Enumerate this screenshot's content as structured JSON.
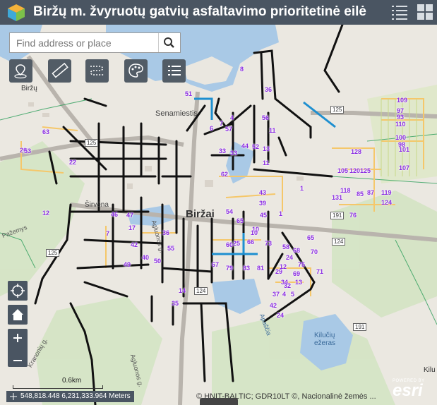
{
  "header": {
    "title": "Biržų m. žvyruotų gatvių asfaltavimo prioritetinė eilė"
  },
  "search": {
    "placeholder": "Find address or place"
  },
  "tools": [
    "locate-tool",
    "measure-tool",
    "layers-tool",
    "basemap-tool",
    "legend-tool"
  ],
  "map": {
    "places": [
      "Biržai",
      "Senamiestis",
      "Širvėna",
      "Kilučių ežeras",
      "Apaščia",
      "Kilu",
      "Biržų"
    ],
    "street_labels": [
      "Pažemys",
      "Kranonių g.",
      "Agluonos g.",
      "Agluonos g."
    ],
    "road_shields": [
      "125",
      "191",
      "125",
      "191",
      "124",
      "125",
      "124"
    ],
    "numbers": [
      {
        "t": "51"
      },
      {
        "t": "8"
      },
      {
        "t": "36"
      },
      {
        "t": "4"
      },
      {
        "t": "7"
      },
      {
        "t": "57"
      },
      {
        "t": "6"
      },
      {
        "t": "56"
      },
      {
        "t": "11"
      },
      {
        "t": "33"
      },
      {
        "t": "33"
      },
      {
        "t": "44"
      },
      {
        "t": "52"
      },
      {
        "t": "13"
      },
      {
        "t": "11"
      },
      {
        "t": "62"
      },
      {
        "t": "43"
      },
      {
        "t": "39"
      },
      {
        "t": "45"
      },
      {
        "t": "54"
      },
      {
        "t": "65"
      },
      {
        "t": "20"
      },
      {
        "t": "63"
      },
      {
        "t": "53"
      },
      {
        "t": "22"
      },
      {
        "t": "12"
      },
      {
        "t": "10"
      },
      {
        "t": "60"
      },
      {
        "t": "7"
      },
      {
        "t": "46"
      },
      {
        "t": "47"
      },
      {
        "t": "17"
      },
      {
        "t": "42"
      },
      {
        "t": "49"
      },
      {
        "t": "40"
      },
      {
        "t": "55"
      },
      {
        "t": "36"
      },
      {
        "t": "50"
      },
      {
        "t": "10"
      },
      {
        "t": "66"
      },
      {
        "t": "25"
      },
      {
        "t": "67"
      },
      {
        "t": "14"
      },
      {
        "t": "35"
      },
      {
        "t": "79"
      },
      {
        "t": "83"
      },
      {
        "t": "81"
      },
      {
        "t": "58"
      },
      {
        "t": "68"
      },
      {
        "t": "70"
      },
      {
        "t": "37"
      },
      {
        "t": "42"
      },
      {
        "t": "34"
      },
      {
        "t": "69"
      },
      {
        "t": "75"
      },
      {
        "t": "71"
      },
      {
        "t": "109"
      },
      {
        "t": "97"
      },
      {
        "t": "93"
      },
      {
        "t": "110"
      },
      {
        "t": "100"
      },
      {
        "t": "98"
      },
      {
        "t": "101"
      },
      {
        "t": "107"
      },
      {
        "t": "128"
      },
      {
        "t": "105"
      },
      {
        "t": "120"
      },
      {
        "t": "125"
      },
      {
        "t": "1"
      },
      {
        "t": "131"
      },
      {
        "t": "118"
      },
      {
        "t": "85"
      },
      {
        "t": "87"
      },
      {
        "t": "76"
      },
      {
        "t": "119"
      },
      {
        "t": "124"
      },
      {
        "t": "1"
      },
      {
        "t": "73"
      },
      {
        "t": "29"
      },
      {
        "t": "12"
      },
      {
        "t": "24"
      },
      {
        "t": "32"
      },
      {
        "t": "4"
      },
      {
        "t": "5"
      },
      {
        "t": "13"
      },
      {
        "t": "24"
      },
      {
        "t": "65"
      },
      {
        "t": "48"
      }
    ]
  },
  "scale": {
    "label": "0.6km"
  },
  "coords": {
    "text": "548,818.448 6,231,333.964 Meters"
  },
  "attribution": {
    "text": "© HNIT-BALTIC; GDR10LT ©, Nacionalinė žemės ..."
  },
  "esri": {
    "powered": "POWERED BY",
    "word": "esri"
  },
  "colors": {
    "header": "#4a5562",
    "road_black": "#111111",
    "road_yellow": "#f5c76a",
    "blue_segment": "#1e8fd0",
    "label_purple": "#8a2be2",
    "water": "#a9c9e6"
  }
}
